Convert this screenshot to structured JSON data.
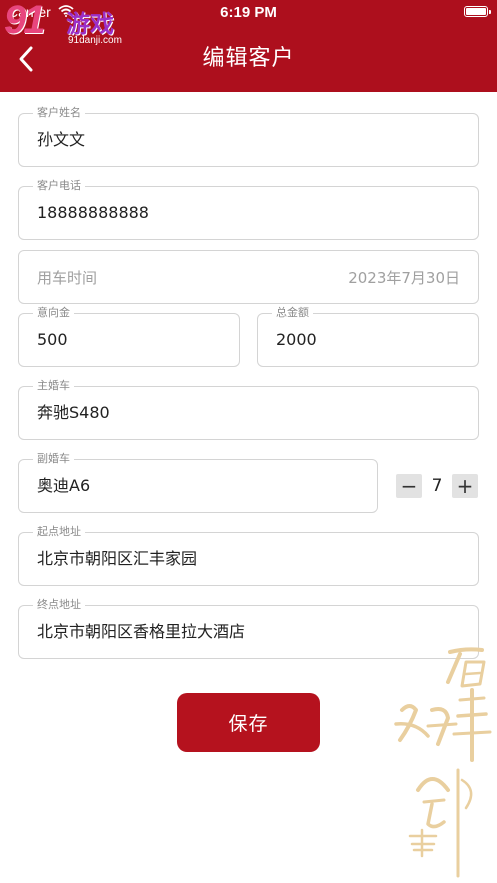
{
  "status_bar": {
    "carrier": "Carrier",
    "time": "6:19 PM"
  },
  "watermark": {
    "number": "91",
    "chinese": "游戏",
    "url": "91danji.com"
  },
  "header": {
    "title": "编辑客户"
  },
  "form": {
    "customer_name": {
      "label": "客户姓名",
      "value": "孙文文"
    },
    "customer_phone": {
      "label": "客户电话",
      "value": "18888888888"
    },
    "car_time": {
      "placeholder": "用车时间",
      "value": "2023年7月30日"
    },
    "deposit": {
      "label": "意向金",
      "value": "500"
    },
    "total_amount": {
      "label": "总金额",
      "value": "2000"
    },
    "main_car": {
      "label": "主婚车",
      "value": "奔驰S480"
    },
    "secondary_car": {
      "label": "副婚车",
      "value": "奥迪A6",
      "count": "7",
      "minus": "−",
      "plus": "+"
    },
    "start_address": {
      "label": "起点地址",
      "value": "北京市朝阳区汇丰家园"
    },
    "end_address": {
      "label": "终点地址",
      "value": "北京市朝阳区香格里拉大酒店"
    }
  },
  "save_label": "保存",
  "colors": {
    "brand_red": "#ad0f1d",
    "button_red": "#b5121e",
    "decor_gold": "#e9cf9f"
  }
}
